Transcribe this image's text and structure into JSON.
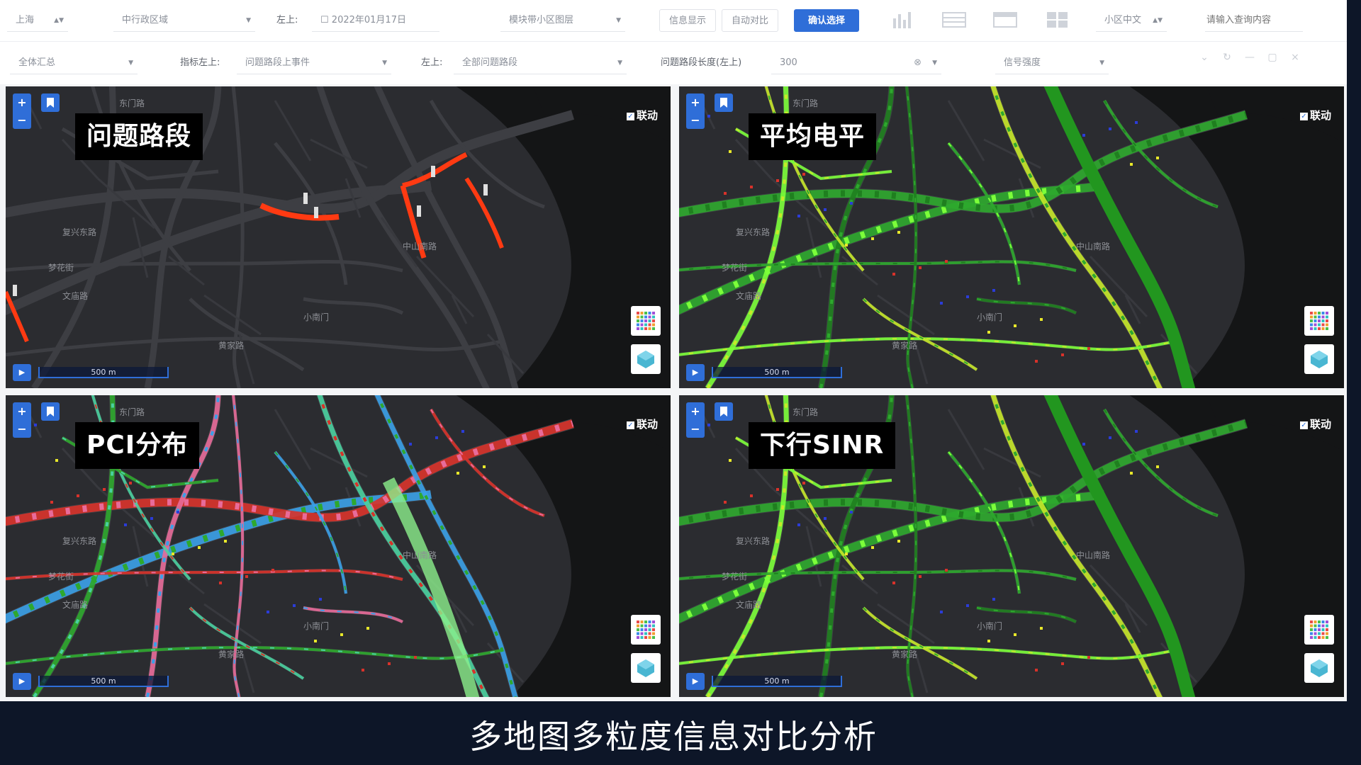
{
  "toolbar": {
    "row1": {
      "city": "上海",
      "district": "中行政区域",
      "date_label": "左上:",
      "date_value": "2022年01月17日",
      "layer_select": "模块带小区图层",
      "btn_info": "信息显示",
      "btn_region": "自动对比",
      "btn_primary": "确认选择",
      "cell_select": "小区中文",
      "search_placeholder": "请输入查询内容"
    },
    "row2": {
      "scope": "全体汇总",
      "metric_label": "指标左上:",
      "metric_value": "问题路段上事件",
      "left_label": "左上:",
      "left_value": "全部问题路段",
      "threshold_label": "问题路段长度(左上)",
      "threshold_value": "300",
      "mode_value": "信号强度"
    }
  },
  "maps": [
    {
      "title": "问题路段",
      "linkage": "联动",
      "scale": "500 m"
    },
    {
      "title": "平均电平",
      "linkage": "联动",
      "scale": "500 m"
    },
    {
      "title": "PCI分布",
      "linkage": "联动",
      "scale": "500 m"
    },
    {
      "title": "下行SINR",
      "linkage": "联动",
      "scale": "500 m"
    }
  ],
  "map_labels": [
    "东门路",
    "复兴东路",
    "中山南路",
    "小南门",
    "黄家路",
    "文庙路",
    "梦花街"
  ],
  "icons": {
    "zoom_in": "plus-icon",
    "zoom_out": "minus-icon",
    "bookmark": "bookmark-icon",
    "grid": "grid-icon",
    "layers": "layers-icon",
    "play": "play-icon"
  },
  "colors": {
    "accent": "#2f6ed8",
    "problem_road": "#ff3a12",
    "level_good": "#2ea82e",
    "level_bright": "#7cff3a",
    "pci_blue": "#3aa0e8",
    "pci_red": "#d8322a"
  },
  "caption": "多地图多粒度信息对比分析"
}
